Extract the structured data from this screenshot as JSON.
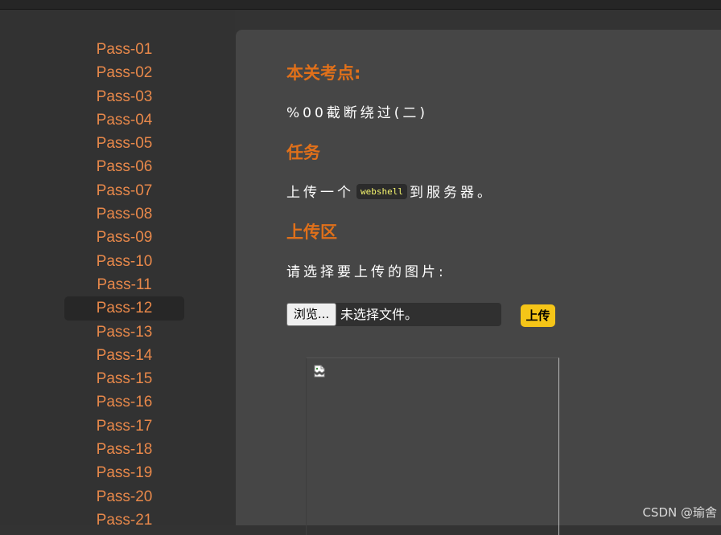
{
  "sidebar": {
    "items": [
      {
        "label": "Pass-01"
      },
      {
        "label": "Pass-02"
      },
      {
        "label": "Pass-03"
      },
      {
        "label": "Pass-04"
      },
      {
        "label": "Pass-05"
      },
      {
        "label": "Pass-06"
      },
      {
        "label": "Pass-07"
      },
      {
        "label": "Pass-08"
      },
      {
        "label": "Pass-09"
      },
      {
        "label": "Pass-10"
      },
      {
        "label": "Pass-11"
      },
      {
        "label": "Pass-12",
        "active": true
      },
      {
        "label": "Pass-13"
      },
      {
        "label": "Pass-14"
      },
      {
        "label": "Pass-15"
      },
      {
        "label": "Pass-16"
      },
      {
        "label": "Pass-17"
      },
      {
        "label": "Pass-18"
      },
      {
        "label": "Pass-19"
      },
      {
        "label": "Pass-20"
      },
      {
        "label": "Pass-21"
      }
    ]
  },
  "main": {
    "exam_point_title": "本关考点:",
    "exam_point_text": "%00截断绕过(二)",
    "task_title": "任务",
    "task_text_before": "上传一个",
    "task_code": "webshell",
    "task_text_after": "到服务器。",
    "upload_area_title": "上传区",
    "upload_prompt": "请选择要上传的图片:",
    "file_input": {
      "button_label": "浏览...",
      "status_text": "未选择文件。"
    },
    "upload_button_label": "上传",
    "preview_icon": "broken-image-icon"
  },
  "watermark": "CSDN @瑜舍",
  "colors": {
    "accent": "#e0701a",
    "nav_link": "#e8884a",
    "upload_button": "#f5c518",
    "code_text": "#f5f56e"
  }
}
